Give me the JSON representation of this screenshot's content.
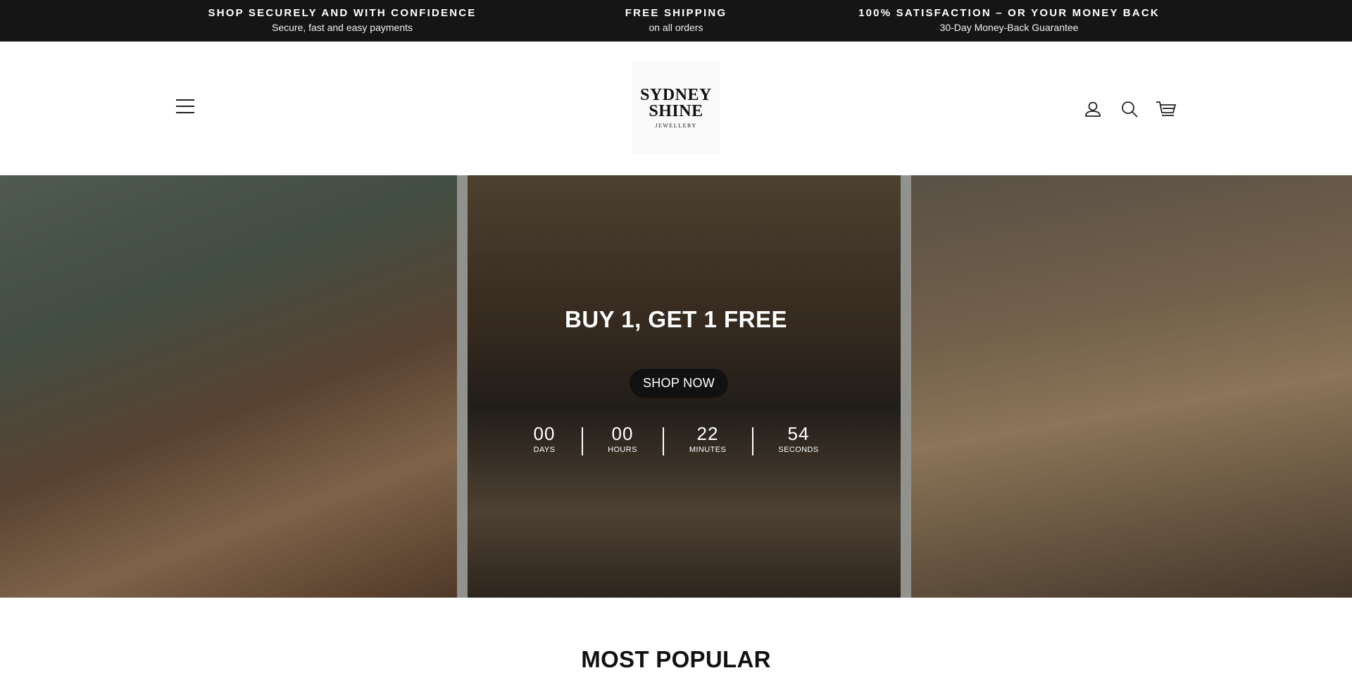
{
  "announcement": [
    {
      "title": "SHOP SECURELY AND WITH CONFIDENCE",
      "subtitle": "Secure, fast and easy payments"
    },
    {
      "title": "FREE SHIPPING",
      "subtitle": "on all orders"
    },
    {
      "title": "100% SATISFACTION – OR YOUR MONEY BACK",
      "subtitle": "30-Day Money-Back Guarantee"
    }
  ],
  "header": {
    "logo": {
      "line1": "SYDNEY",
      "line2": "SHINE",
      "line3": "JEWELLERY"
    },
    "icons": {
      "menu": "hamburger-menu-icon",
      "account": "user-icon",
      "search": "search-icon",
      "cart": "cart-icon"
    }
  },
  "hero": {
    "title": "BUY 1, GET 1 FREE",
    "cta_label": "SHOP NOW",
    "countdown": [
      {
        "value": "00",
        "label": "DAYS"
      },
      {
        "value": "00",
        "label": "HOURS"
      },
      {
        "value": "22",
        "label": "MINUTES"
      },
      {
        "value": "54",
        "label": "SECONDS"
      }
    ]
  },
  "section": {
    "title": "MOST POPULAR"
  },
  "colors": {
    "announcement_bg": "#151515",
    "button_bg": "#111111",
    "text": "#111111",
    "white": "#ffffff"
  }
}
